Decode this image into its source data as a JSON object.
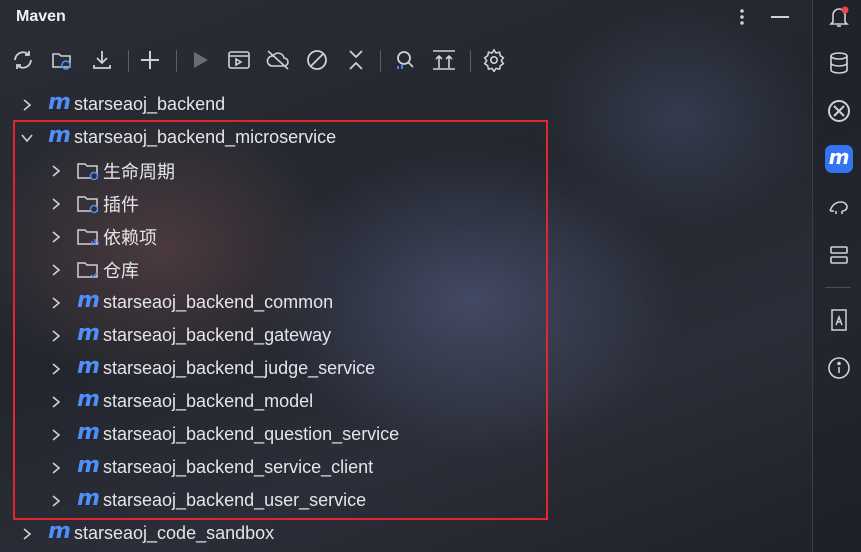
{
  "panel": {
    "title": "Maven"
  },
  "toolbar": {
    "buttons": [
      "reload-all",
      "generate-sources",
      "download",
      "add-project",
      "run",
      "execute-goal",
      "toggle-offline",
      "skip-tests",
      "collapse-all",
      "analyze",
      "show-dependencies",
      "settings"
    ]
  },
  "tree": {
    "root1": "starseaoj_backend",
    "root2": "starseaoj_backend_microservice",
    "lifecycle": "生命周期",
    "plugins": "插件",
    "dependencies": "依赖项",
    "repositories": "仓库",
    "modules": [
      "starseaoj_backend_common",
      "starseaoj_backend_gateway",
      "starseaoj_backend_judge_service",
      "starseaoj_backend_model",
      "starseaoj_backend_question_service",
      "starseaoj_backend_service_client",
      "starseaoj_backend_user_service"
    ],
    "root3": "starseaoj_code_sandbox"
  },
  "colors": {
    "accent": "#3574f0",
    "maven_blue": "#4f8ff7",
    "highlight": "#e0262e"
  },
  "sidebar": {
    "icons": [
      "notifications-icon",
      "database-icon",
      "ai-assistant-icon",
      "maven-icon",
      "gradle-icon",
      "services-icon",
      "translate-icon",
      "info-icon"
    ],
    "active": "maven-icon"
  }
}
